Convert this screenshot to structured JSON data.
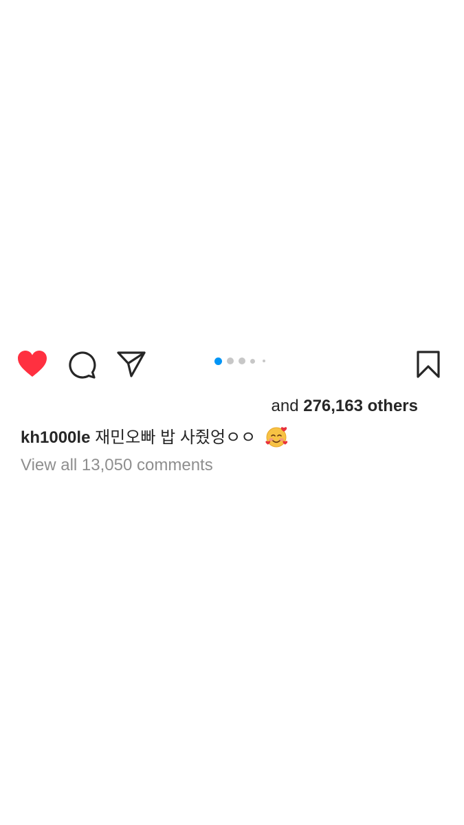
{
  "post": {
    "actions": {
      "like_icon": "heart-filled-icon",
      "comment_icon": "comment-bubble-icon",
      "share_icon": "paper-plane-icon",
      "save_icon": "bookmark-icon",
      "like_color": "#ff3040"
    },
    "carousel": {
      "total_dots": 5,
      "active_index": 0,
      "active_color": "#0095f6"
    },
    "likes": {
      "prefix": "and",
      "count": "276,163 others"
    },
    "caption": {
      "username": "kh1000le",
      "text": "재민오빠 밥 사줬엉ㅇㅇ",
      "emoji": "smiling-face-with-hearts-icon"
    },
    "comments": {
      "view_all_label": "View all 13,050 comments"
    }
  }
}
